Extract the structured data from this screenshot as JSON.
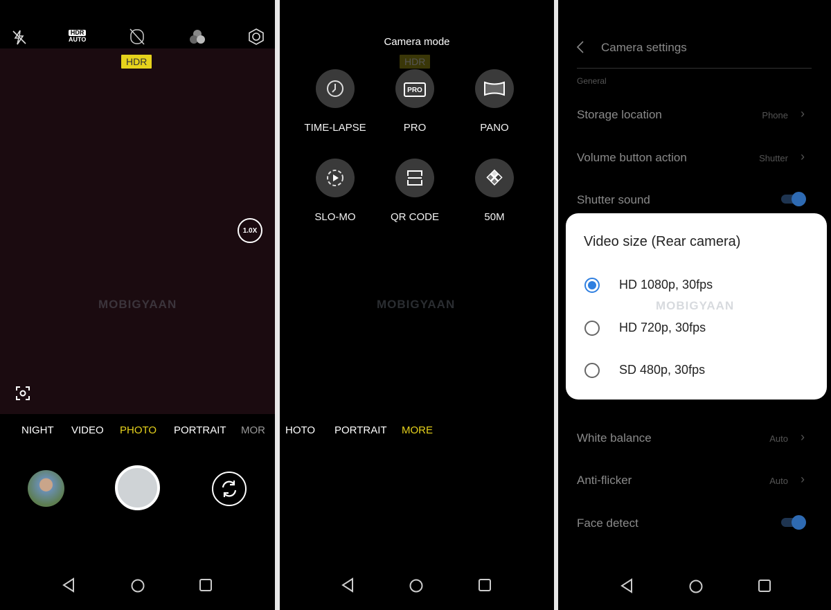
{
  "screen1": {
    "top_icons": [
      "flash-off-icon",
      "hdr-auto-icon",
      "ai-off-icon",
      "filter-icon",
      "settings-icon"
    ],
    "hdr_auto": {
      "top": "HDR",
      "bottom": "AUTO"
    },
    "hdr_badge": "HDR",
    "zoom_level": "1.0X",
    "modes": [
      "NIGHT",
      "VIDEO",
      "PHOTO",
      "PORTRAIT",
      "MOR"
    ],
    "active_mode": "PHOTO",
    "accent_color": "#e6d21c",
    "watermark": "MOBIGYAAN"
  },
  "screen2": {
    "title": "Camera mode",
    "hdr_badge": "HDR",
    "modes": [
      {
        "label": "TIME-LAPSE",
        "icon": "timelapse-icon"
      },
      {
        "label": "PRO",
        "icon": "pro-icon",
        "icon_text": "PRO"
      },
      {
        "label": "PANO",
        "icon": "pano-icon"
      },
      {
        "label": "SLO-MO",
        "icon": "slomo-icon"
      },
      {
        "label": "QR CODE",
        "icon": "qr-code-icon"
      },
      {
        "label": "50M",
        "icon": "50m-icon"
      }
    ],
    "mode_bar": [
      "HOTO",
      "PORTRAIT",
      "MORE"
    ],
    "active_mode": "MORE",
    "watermark": "MOBIGYAAN"
  },
  "screen3": {
    "title": "Camera settings",
    "section": "General",
    "rows": [
      {
        "label": "Storage location",
        "value": "Phone"
      },
      {
        "label": "Volume button action",
        "value": "Shutter"
      },
      {
        "label": "Shutter sound",
        "toggle": true
      },
      {
        "label": "White balance",
        "value": "Auto"
      },
      {
        "label": "Anti-flicker",
        "value": "Auto"
      },
      {
        "label": "Face detect",
        "toggle": true
      }
    ],
    "dialog": {
      "title": "Video size (Rear camera)",
      "options": [
        "HD 1080p, 30fps",
        "HD 720p, 30fps",
        "SD 480p, 30fps"
      ],
      "selected": "HD 1080p, 30fps"
    },
    "toggle_color": "#2e6ab2",
    "radio_color": "#2f7fe0",
    "watermark": "MOBIGYAAN"
  }
}
